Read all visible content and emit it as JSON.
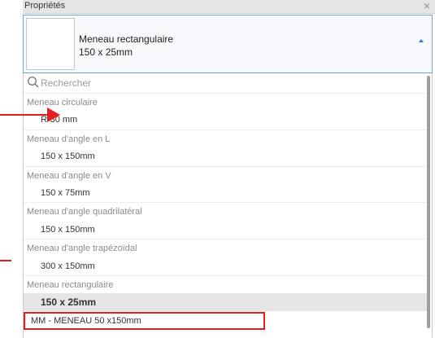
{
  "panel": {
    "title": "Propriétés",
    "close_glyph": "×"
  },
  "type_selector": {
    "name": "Meneau rectangulaire",
    "size": "150 x 25mm",
    "arrow_icon": "chevron-up-icon"
  },
  "search": {
    "placeholder": "Rechercher",
    "value": "",
    "icon": "search-icon"
  },
  "list": [
    {
      "kind": "family",
      "label": "Meneau circulaire"
    },
    {
      "kind": "item",
      "label": "R-30 mm"
    },
    {
      "kind": "family",
      "label": "Meneau d'angle en L"
    },
    {
      "kind": "item",
      "label": "150 x 150mm"
    },
    {
      "kind": "family",
      "label": "Meneau d'angle en V"
    },
    {
      "kind": "item",
      "label": "150 x 75mm"
    },
    {
      "kind": "family",
      "label": "Meneau d'angle quadrilatéral"
    },
    {
      "kind": "item",
      "label": "150 x 150mm"
    },
    {
      "kind": "family",
      "label": "Meneau d'angle trapézoïdal"
    },
    {
      "kind": "item",
      "label": "300 x 150mm"
    },
    {
      "kind": "family",
      "label": "Meneau rectangulaire"
    },
    {
      "kind": "item",
      "label": "150 x 25mm",
      "selected": true
    },
    {
      "kind": "item",
      "label": "MM  - MENEAU 50 x150mm",
      "highlighted": true
    }
  ],
  "colors": {
    "annotation": "#e02020",
    "accent": "#3b7bbf"
  }
}
